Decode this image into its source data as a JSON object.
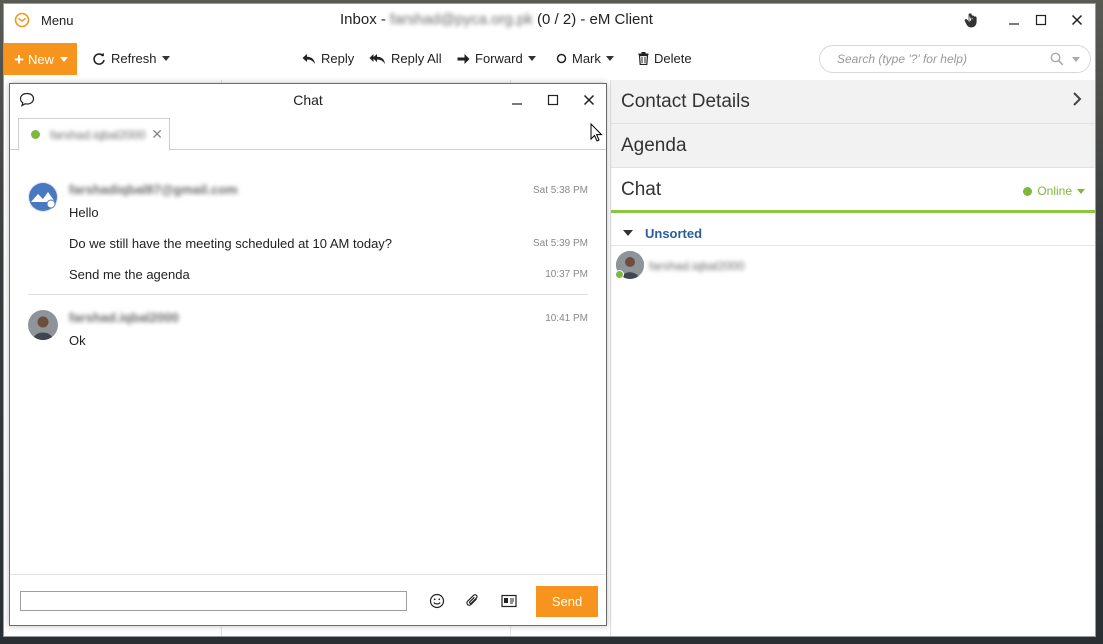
{
  "colors": {
    "accent": "#f7941d",
    "online": "#7cb83a",
    "group": "#2a5f9e"
  },
  "titlebar": {
    "menu_label": "Menu",
    "title_prefix": "Inbox - ",
    "title_account": "farshad@pyca.org.pk",
    "title_suffix": " (0 / 2) - eM Client"
  },
  "toolbar": {
    "new_label": "New",
    "refresh_label": "Refresh",
    "reply_label": "Reply",
    "reply_all_label": "Reply All",
    "forward_label": "Forward",
    "mark_label": "Mark",
    "delete_label": "Delete",
    "search_placeholder": "Search (type '?' for help)"
  },
  "right_pane": {
    "contact_details": "Contact Details",
    "agenda": "Agenda",
    "chat": "Chat",
    "status": "Online",
    "group": "Unsorted",
    "contacts": [
      {
        "name": "farshad.iqbal2000",
        "status": "online"
      }
    ]
  },
  "chat_window": {
    "title": "Chat",
    "tab_label": "farshad.iqbal2000",
    "messages": [
      {
        "sender": "farshadiqbal87@gmail.com",
        "lines": [
          {
            "text": "Hello",
            "time": "Sat 5:38 PM"
          },
          {
            "text": "Do we still have the meeting scheduled at 10 AM today?",
            "time": "Sat 5:39 PM"
          },
          {
            "text": "Send me the agenda",
            "time": "10:37 PM"
          }
        ]
      },
      {
        "sender": "farshad.iqbal2000",
        "lines": [
          {
            "text": "Ok",
            "time": "10:41 PM"
          }
        ]
      }
    ],
    "input_value": "",
    "send_label": "Send"
  }
}
